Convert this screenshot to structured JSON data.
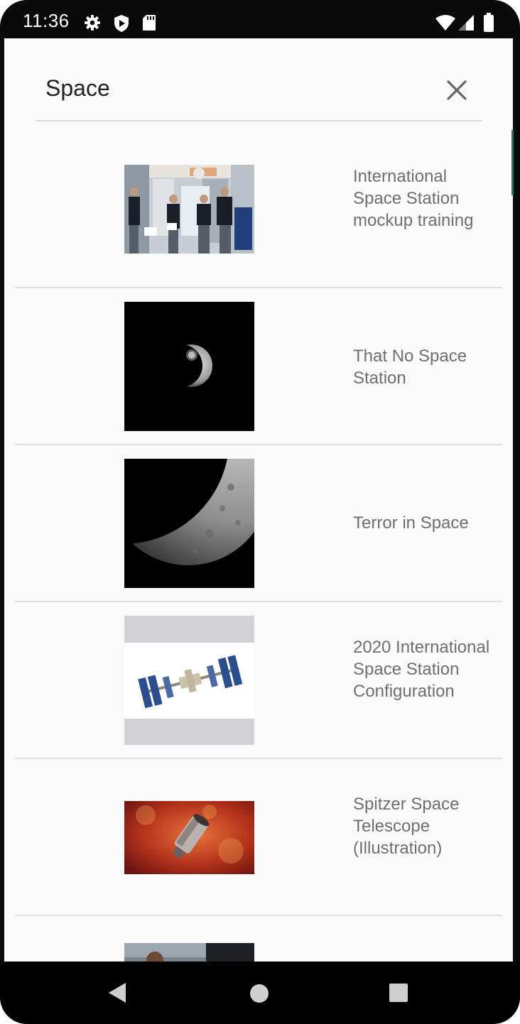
{
  "status_bar": {
    "time": "11:36",
    "icons": [
      "gear-icon",
      "shield-play-icon",
      "sd-card-icon",
      "wifi-icon",
      "cell-signal-icon",
      "battery-icon"
    ]
  },
  "search": {
    "query": "Space",
    "clear_icon": "close-icon"
  },
  "results": [
    {
      "title": "International Space Station mockup training",
      "thumbnail": "astronauts-in-station-mockup"
    },
    {
      "title": "That No Space Station",
      "thumbnail": "crescent-moon-crater"
    },
    {
      "title": "Terror in Space",
      "thumbnail": "crescent-mercury"
    },
    {
      "title": "2020 International Space Station Configuration",
      "thumbnail": "iss-diagram"
    },
    {
      "title": "Spitzer Space Telescope (Illustration)",
      "thumbnail": "spitzer-telescope-on-red"
    },
    {
      "title": "",
      "thumbnail": "partial-photo"
    }
  ],
  "nav_bar": {
    "back_icon": "back-triangle-icon",
    "home_icon": "home-circle-icon",
    "recents_icon": "recents-square-icon"
  },
  "colors": {
    "screen_bg": "#fafafa",
    "title_text": "#6f6f6f",
    "divider": "#dedede",
    "frame": "#0a0a0a"
  }
}
